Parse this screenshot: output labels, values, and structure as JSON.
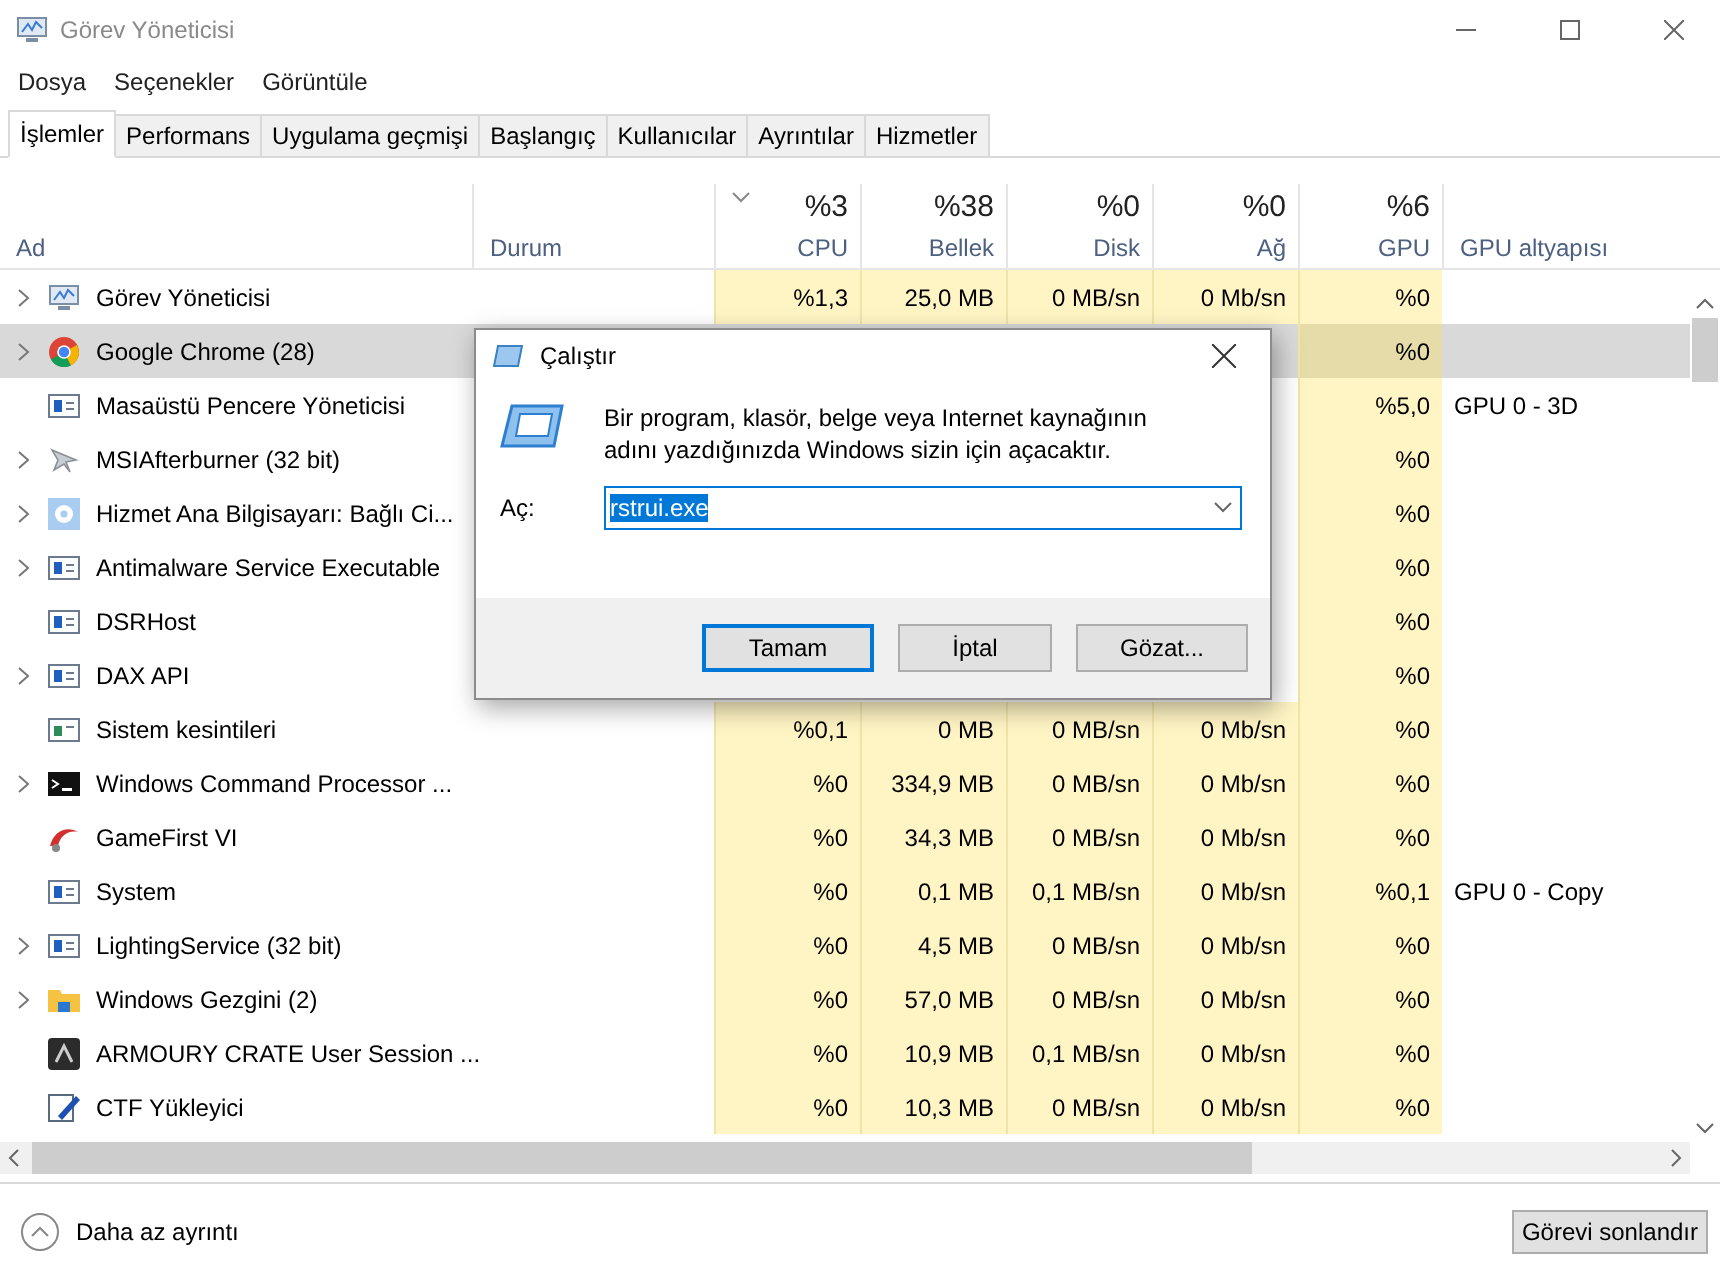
{
  "window": {
    "title": "Görev Yöneticisi"
  },
  "menu": [
    "Dosya",
    "Seçenekler",
    "Görüntüle"
  ],
  "tabs": [
    {
      "label": "İşlemler",
      "selected": true
    },
    {
      "label": "Performans",
      "selected": false
    },
    {
      "label": "Uygulama geçmişi",
      "selected": false
    },
    {
      "label": "Başlangıç",
      "selected": false
    },
    {
      "label": "Kullanıcılar",
      "selected": false
    },
    {
      "label": "Ayrıntılar",
      "selected": false
    },
    {
      "label": "Hizmetler",
      "selected": false
    }
  ],
  "table": {
    "columns": [
      {
        "label": "Ad",
        "kind": "text"
      },
      {
        "label": "Durum",
        "kind": "text"
      },
      {
        "label": "CPU",
        "total": "%3",
        "kind": "metric",
        "sorted": true
      },
      {
        "label": "Bellek",
        "total": "%38",
        "kind": "metric",
        "sorted": false
      },
      {
        "label": "Disk",
        "total": "%0",
        "kind": "metric",
        "sorted": false
      },
      {
        "label": "Ağ",
        "total": "%0",
        "kind": "metric",
        "sorted": false
      },
      {
        "label": "GPU",
        "total": "%6",
        "kind": "metric",
        "sorted": false
      },
      {
        "label": "GPU altyapısı",
        "kind": "text"
      }
    ],
    "rows": [
      {
        "name": "Görev Yöneticisi",
        "expandable": true,
        "selected": false,
        "cpu": "%1,3",
        "memory": "25,0 MB",
        "disk": "0 MB/sn",
        "network": "0 Mb/sn",
        "gpu": "%0"
      },
      {
        "name": "Google Chrome (28)",
        "expandable": true,
        "selected": true,
        "gpu": "%0"
      },
      {
        "name": "Masaüstü Pencere Yöneticisi",
        "expandable": false,
        "selected": false,
        "gpu": "%5,0",
        "gpu_engine": "GPU 0 - 3D"
      },
      {
        "name": "MSIAfterburner (32 bit)",
        "expandable": true,
        "selected": false,
        "gpu": "%0"
      },
      {
        "name": "Hizmet Ana Bilgisayarı: Bağlı Ci...",
        "expandable": true,
        "selected": false,
        "gpu": "%0"
      },
      {
        "name": "Antimalware Service Executable",
        "expandable": true,
        "selected": false,
        "gpu": "%0"
      },
      {
        "name": "DSRHost",
        "expandable": false,
        "selected": false,
        "gpu": "%0"
      },
      {
        "name": "DAX API",
        "expandable": true,
        "selected": false,
        "gpu": "%0"
      },
      {
        "name": "Sistem kesintileri",
        "expandable": false,
        "selected": false,
        "cpu": "%0,1",
        "memory": "0 MB",
        "disk": "0 MB/sn",
        "network": "0 Mb/sn",
        "gpu": "%0"
      },
      {
        "name": "Windows Command Processor ...",
        "expandable": true,
        "selected": false,
        "cpu": "%0",
        "memory": "334,9 MB",
        "disk": "0 MB/sn",
        "network": "0 Mb/sn",
        "gpu": "%0"
      },
      {
        "name": "GameFirst VI",
        "expandable": false,
        "selected": false,
        "cpu": "%0",
        "memory": "34,3 MB",
        "disk": "0 MB/sn",
        "network": "0 Mb/sn",
        "gpu": "%0"
      },
      {
        "name": "System",
        "expandable": false,
        "selected": false,
        "cpu": "%0",
        "memory": "0,1 MB",
        "disk": "0,1 MB/sn",
        "network": "0 Mb/sn",
        "gpu": "%0,1",
        "gpu_engine": "GPU 0 - Copy"
      },
      {
        "name": "LightingService (32 bit)",
        "expandable": true,
        "selected": false,
        "cpu": "%0",
        "memory": "4,5 MB",
        "disk": "0 MB/sn",
        "network": "0 Mb/sn",
        "gpu": "%0"
      },
      {
        "name": "Windows Gezgini (2)",
        "expandable": true,
        "selected": false,
        "cpu": "%0",
        "memory": "57,0 MB",
        "disk": "0 MB/sn",
        "network": "0 Mb/sn",
        "gpu": "%0"
      },
      {
        "name": "ARMOURY CRATE User Session ...",
        "expandable": false,
        "selected": false,
        "cpu": "%0",
        "memory": "10,9 MB",
        "disk": "0,1 MB/sn",
        "network": "0 Mb/sn",
        "gpu": "%0"
      },
      {
        "name": "CTF Yükleyici",
        "expandable": false,
        "selected": false,
        "cpu": "%0",
        "memory": "10,3 MB",
        "disk": "0 MB/sn",
        "network": "0 Mb/sn",
        "gpu": "%0"
      }
    ]
  },
  "footer": {
    "toggle": "Daha az ayrıntı",
    "end_task": "Görevi sonlandır"
  },
  "run_dialog": {
    "title": "Çalıştır",
    "message": "Bir program, klasör, belge veya Internet kaynağının adını yazdığınızda Windows sizin için açacaktır.",
    "label": "Aç:",
    "value": "rstrui.exe",
    "value_selected": true,
    "buttons": [
      {
        "label": "Tamam",
        "default": true
      },
      {
        "label": "İptal",
        "default": false
      },
      {
        "label": "Gözat...",
        "default": false
      }
    ]
  }
}
